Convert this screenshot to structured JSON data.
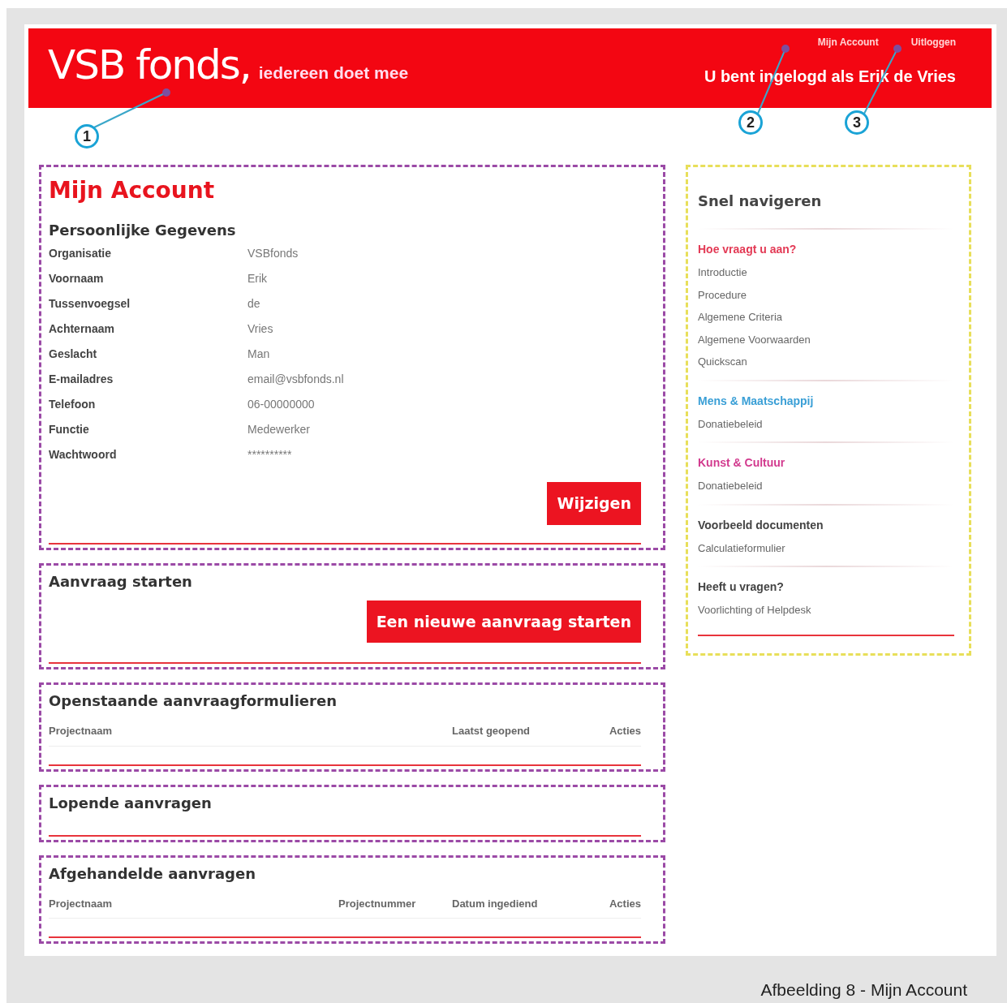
{
  "header": {
    "logo": "VSB fonds,",
    "tagline": "iedereen doet mee",
    "links": [
      {
        "label": "Mijn Account"
      },
      {
        "label": "Uitloggen"
      }
    ],
    "user_text": "U bent ingelogd als Erik de Vries"
  },
  "callouts": [
    {
      "number": "1"
    },
    {
      "number": "2"
    },
    {
      "number": "3"
    }
  ],
  "account": {
    "title": "Mijn Account",
    "subtitle": "Persoonlijke Gegevens",
    "fields": [
      {
        "label": "Organisatie",
        "value": "VSBfonds"
      },
      {
        "label": "Voornaam",
        "value": "Erik"
      },
      {
        "label": "Tussenvoegsel",
        "value": "de"
      },
      {
        "label": "Achternaam",
        "value": "Vries"
      },
      {
        "label": "Geslacht",
        "value": "Man"
      },
      {
        "label": "E-mailadres",
        "value": "email@vsbfonds.nl"
      },
      {
        "label": "Telefoon",
        "value": "06-00000000"
      },
      {
        "label": "Functie",
        "value": "Medewerker"
      },
      {
        "label": "Wachtwoord",
        "value": "**********"
      }
    ],
    "button": "Wijzigen"
  },
  "sections": [
    {
      "kind": "action",
      "title": "Aanvraag starten",
      "button": "Een nieuwe aanvraag starten"
    },
    {
      "kind": "table",
      "title": "Openstaande aanvraagformulieren",
      "columns": [
        "Projectnaam",
        "Laatst geopend",
        "Acties"
      ]
    },
    {
      "kind": "empty",
      "title": "Lopende aanvragen"
    },
    {
      "kind": "table",
      "title": "Afgehandelde aanvragen",
      "columns": [
        "Projectnaam",
        "Projectnummer",
        "Datum ingediend",
        "Acties"
      ]
    }
  ],
  "sidebar": {
    "title": "Snel navigeren",
    "groups": [
      {
        "heading": "Hoe vraagt u aan?",
        "color": "#e33a55",
        "links": [
          "Introductie",
          "Procedure",
          "Algemene Criteria",
          "Algemene Voorwaarden",
          "Quickscan"
        ]
      },
      {
        "heading": "Mens & Maatschappij",
        "color": "#3a9fd6",
        "links": [
          "Donatiebeleid"
        ]
      },
      {
        "heading": "Kunst & Cultuur",
        "color": "#d23a8e",
        "links": [
          "Donatiebeleid"
        ]
      },
      {
        "heading": "Voorbeeld documenten",
        "color": "#444444",
        "links": [
          "Calculatieformulier"
        ]
      },
      {
        "heading": "Heeft u vragen?",
        "color": "#444444",
        "links": [
          "Voorlichting of Helpdesk"
        ]
      }
    ]
  },
  "caption": "Afbeelding 8 - Mijn Account"
}
